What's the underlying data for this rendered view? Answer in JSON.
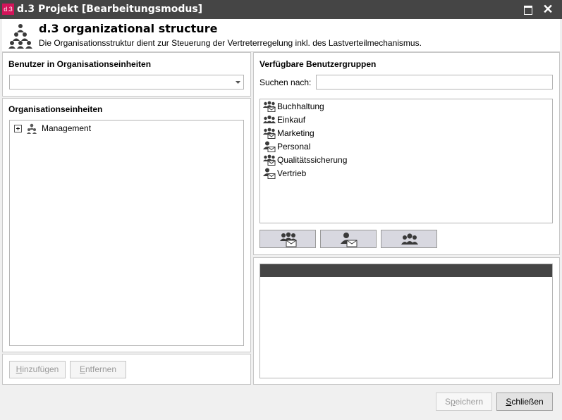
{
  "window": {
    "logo_text": "d.3",
    "title": "d.3 Projekt [Bearbeitungsmodus]",
    "close_glyph": "✕"
  },
  "header": {
    "title": "d.3 organizational structure",
    "description": "Die Organisationsstruktur dient zur Steuerung der Vertreterregelung inkl. des Lastverteilmechanismus."
  },
  "left": {
    "users_section_title": "Benutzer in Organisationseinheiten",
    "users_dropdown_value": "",
    "org_units_title": "Organisationseinheiten",
    "tree": [
      {
        "label": "Management",
        "expanded": false
      }
    ],
    "add_button": {
      "prefix": "",
      "accel": "H",
      "rest": "inzufügen"
    },
    "remove_button": {
      "prefix": "",
      "accel": "E",
      "rest": "ntfernen"
    }
  },
  "right": {
    "groups_title": "Verfügbare Benutzergruppen",
    "search_label": "Suchen nach:",
    "search_value": "",
    "groups": [
      {
        "label": "Buchhaltung",
        "icon": "group-mail-icon"
      },
      {
        "label": "Einkauf",
        "icon": "group-icon"
      },
      {
        "label": "Marketing",
        "icon": "group-mail-icon"
      },
      {
        "label": "Personal",
        "icon": "user-mail-icon"
      },
      {
        "label": "Qualitätssicherung",
        "icon": "group-mail-icon"
      },
      {
        "label": "Vertrieb",
        "icon": "user-mail-icon"
      }
    ]
  },
  "footer": {
    "save_button": {
      "prefix": "S",
      "accel": "p",
      "rest": "eichern"
    },
    "close_button": {
      "prefix": "",
      "accel": "S",
      "rest": "chließen"
    }
  },
  "colors": {
    "titlebar": "#454545",
    "logo": "#d4145a",
    "tool_button": "#d8d8e0"
  }
}
